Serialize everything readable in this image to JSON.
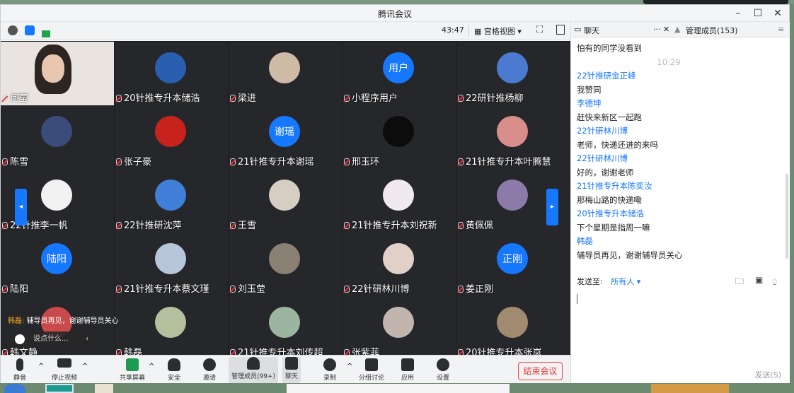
{
  "window": {
    "title": "腾讯会议",
    "min_label": "–",
    "max_label": "☐",
    "close_label": "✕"
  },
  "toolbar": {
    "timer": "43:47",
    "view_label": "宫格视图"
  },
  "participants": [
    {
      "name": "何莹",
      "avatar_text": "",
      "color": "#d9c8bd",
      "video": true
    },
    {
      "name": "20针推专升本储浩",
      "avatar_text": "",
      "color": "#2a5fb0"
    },
    {
      "name": "梁进",
      "avatar_text": "",
      "color": "#cdbba6"
    },
    {
      "name": "小程序用户",
      "avatar_text": "用户",
      "color": "#1677ff"
    },
    {
      "name": "22研针推杨柳",
      "avatar_text": "",
      "color": "#4a7bd0"
    },
    {
      "name": "陈雪",
      "avatar_text": "",
      "color": "#3b4c7a"
    },
    {
      "name": "张子豪",
      "avatar_text": "",
      "color": "#c8221c"
    },
    {
      "name": "21针推专升本谢瑶",
      "avatar_text": "谢瑶",
      "color": "#1677ff"
    },
    {
      "name": "邢玉环",
      "avatar_text": "",
      "color": "#0c0c0c"
    },
    {
      "name": "21针推专升本叶腾慧",
      "avatar_text": "",
      "color": "#d88f8c"
    },
    {
      "name": "22针推李一帆",
      "avatar_text": "",
      "color": "#f2f2f2"
    },
    {
      "name": "22针推研沈萍",
      "avatar_text": "",
      "color": "#3f7fd8"
    },
    {
      "name": "王雪",
      "avatar_text": "",
      "color": "#d6cdc3"
    },
    {
      "name": "21针推专升本刘祝新",
      "avatar_text": "",
      "color": "#f0e9ee"
    },
    {
      "name": "黄佩佩",
      "avatar_text": "",
      "color": "#8c7aa8"
    },
    {
      "name": "陆阳",
      "avatar_text": "陆阳",
      "color": "#1677ff"
    },
    {
      "name": "21针推专升本蔡文瑾",
      "avatar_text": "",
      "color": "#b7c6d9"
    },
    {
      "name": "刘玉莹",
      "avatar_text": "",
      "color": "#8a8073"
    },
    {
      "name": "22针研林川博",
      "avatar_text": "",
      "color": "#e0d0c8"
    },
    {
      "name": "姜正刚",
      "avatar_text": "正刚",
      "color": "#1677ff"
    },
    {
      "name": "韩文静",
      "avatar_text": "",
      "color": "#c84a4a"
    },
    {
      "name": "韩磊",
      "avatar_text": "",
      "color": "#b4c09e"
    },
    {
      "name": "21针推专升本刘传超",
      "avatar_text": "",
      "color": "#9bb5a0"
    },
    {
      "name": "张紫菲",
      "avatar_text": "",
      "color": "#c2b5ad"
    },
    {
      "name": "20针推专升本张岚",
      "avatar_text": "",
      "color": "#a08a70"
    }
  ],
  "overlay": {
    "chat_sender": "韩磊:",
    "chat_text": "辅导员再见，谢谢辅导员关心",
    "say_placeholder": "说点什么..."
  },
  "bottombar": {
    "mute": "静音",
    "stop_video": "停止视频",
    "share": "共享屏幕",
    "security": "安全",
    "invite": "邀请",
    "members": "管理成员(99+)",
    "chat": "聊天",
    "record": "录制",
    "breakout": "分组讨论",
    "apps": "应用",
    "settings": "设置",
    "end": "结束会议"
  },
  "panel": {
    "chat_tab": "聊天",
    "members_tab": "管理成员(153)",
    "messages": [
      {
        "sender": "",
        "text": "怕有的同学没看到"
      },
      {
        "sender": "",
        "text": "",
        "time": "10:29"
      },
      {
        "sender": "22针推研金正峰",
        "text": "我赞同"
      },
      {
        "sender": "李德坤",
        "text": "赶快来新区一起跑"
      },
      {
        "sender": "22针研林川博",
        "text": "老师，快递还进的来吗"
      },
      {
        "sender": "22针研林川博",
        "text": "好的，谢谢老师"
      },
      {
        "sender": "21针推专升本陈奕汝",
        "text": "那梅山路的快递嘞"
      },
      {
        "sender": "20针推专升本储浩",
        "text": "下个星期是指周一嘛"
      },
      {
        "sender": "韩磊",
        "text": "辅导员再见，谢谢辅导员关心"
      }
    ],
    "send_to_label": "发送至:",
    "send_to_value": "所有人",
    "send_button": "发送(S)"
  },
  "colors": {
    "accent": "#1677ff",
    "end_red": "#e33"
  }
}
